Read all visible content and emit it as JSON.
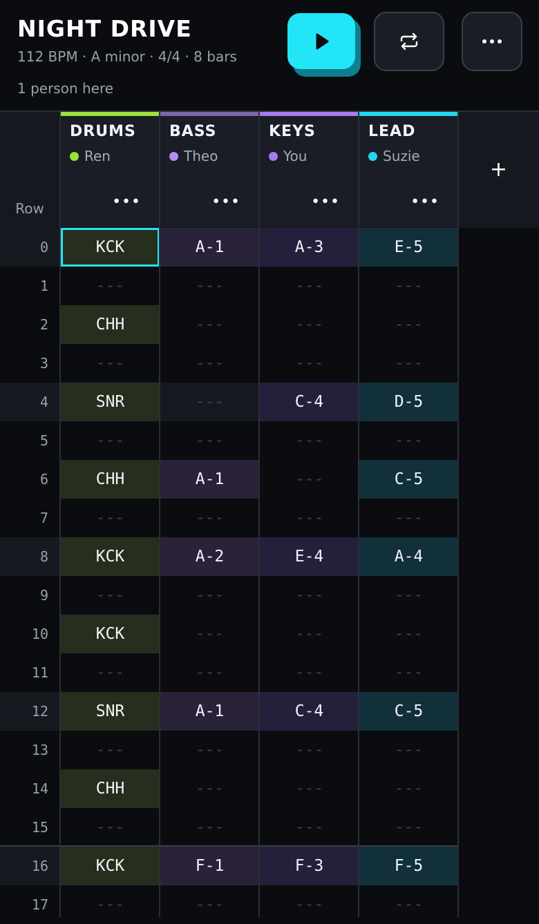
{
  "song": {
    "title": "NIGHT DRIVE",
    "meta": "112 BPM · A minor · 4/4 · 8 bars",
    "presence": "1 person here"
  },
  "toolbar": {
    "play_icon": "play-icon",
    "loop_icon": "loop-icon",
    "more_icon": "more-icon",
    "more_label": "•••"
  },
  "colors": {
    "accent": "#22e6f7",
    "drums": "#9be33a",
    "bass": "#b98af0",
    "keys": "#a77bf0",
    "lead": "#22d8ee"
  },
  "grid": {
    "row_header": "Row",
    "add_track": "+",
    "track_menu": "•••",
    "empty_cell": "---"
  },
  "tracks": [
    {
      "name": "DRUMS",
      "owner": "Ren"
    },
    {
      "name": "BASS",
      "owner": "Theo"
    },
    {
      "name": "KEYS",
      "owner": "You"
    },
    {
      "name": "LEAD",
      "owner": "Suzie"
    }
  ],
  "rows": [
    {
      "n": "0",
      "cells": [
        "KCK",
        "A-1",
        "A-3",
        "E-5"
      ]
    },
    {
      "n": "1",
      "cells": [
        "",
        "",
        "",
        ""
      ]
    },
    {
      "n": "2",
      "cells": [
        "CHH",
        "",
        "",
        ""
      ]
    },
    {
      "n": "3",
      "cells": [
        "",
        "",
        "",
        ""
      ]
    },
    {
      "n": "4",
      "cells": [
        "SNR",
        "",
        "C-4",
        "D-5"
      ]
    },
    {
      "n": "5",
      "cells": [
        "",
        "",
        "",
        ""
      ]
    },
    {
      "n": "6",
      "cells": [
        "CHH",
        "A-1",
        "",
        "C-5"
      ]
    },
    {
      "n": "7",
      "cells": [
        "",
        "",
        "",
        ""
      ]
    },
    {
      "n": "8",
      "cells": [
        "KCK",
        "A-2",
        "E-4",
        "A-4"
      ]
    },
    {
      "n": "9",
      "cells": [
        "",
        "",
        "",
        ""
      ]
    },
    {
      "n": "10",
      "cells": [
        "KCK",
        "",
        "",
        ""
      ]
    },
    {
      "n": "11",
      "cells": [
        "",
        "",
        "",
        ""
      ]
    },
    {
      "n": "12",
      "cells": [
        "SNR",
        "A-1",
        "C-4",
        "C-5"
      ]
    },
    {
      "n": "13",
      "cells": [
        "",
        "",
        "",
        ""
      ]
    },
    {
      "n": "14",
      "cells": [
        "CHH",
        "",
        "",
        ""
      ]
    },
    {
      "n": "15",
      "cells": [
        "",
        "",
        "",
        ""
      ]
    },
    {
      "n": "16",
      "cells": [
        "KCK",
        "F-1",
        "F-3",
        "F-5"
      ]
    },
    {
      "n": "17",
      "cells": [
        "",
        "",
        "",
        ""
      ]
    }
  ],
  "selected_cell": {
    "row": "0",
    "track": "DRUMS"
  }
}
